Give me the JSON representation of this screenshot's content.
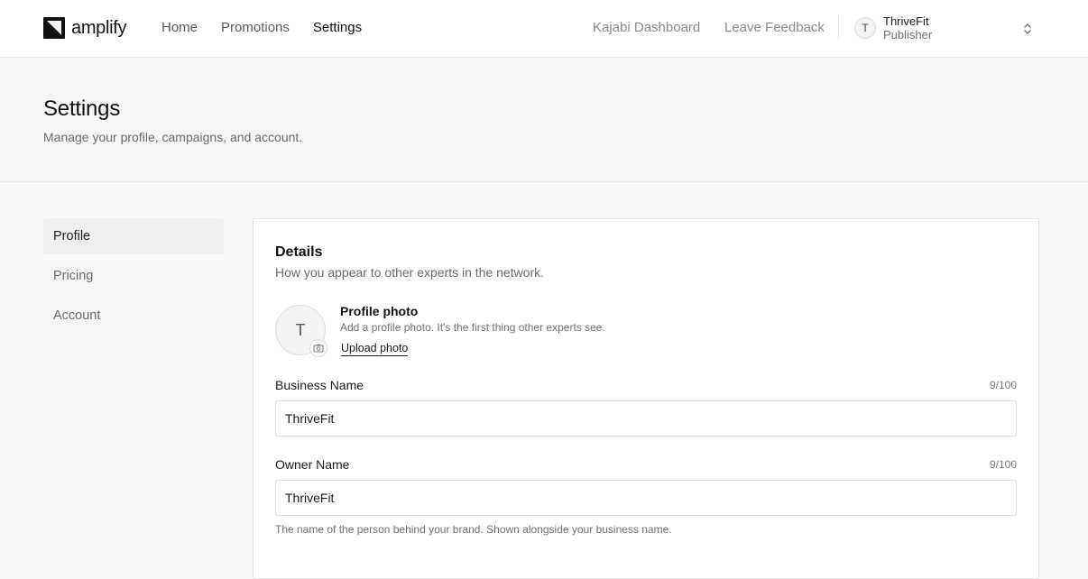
{
  "app": {
    "brand": "amplify",
    "nav": [
      {
        "label": "Home"
      },
      {
        "label": "Promotions"
      },
      {
        "label": "Settings"
      }
    ],
    "links": {
      "dashboard": "Kajabi Dashboard",
      "feedback": "Leave Feedback"
    },
    "user": {
      "initial": "T",
      "name": "ThriveFit",
      "role": "Publisher"
    }
  },
  "page": {
    "title": "Settings",
    "subtitle": "Manage your profile, campaigns, and account."
  },
  "sidebar": {
    "items": [
      {
        "label": "Profile",
        "active": true
      },
      {
        "label": "Pricing",
        "active": false
      },
      {
        "label": "Account",
        "active": false
      }
    ]
  },
  "details": {
    "title": "Details",
    "subtitle": "How you appear to other experts in the network.",
    "photo": {
      "initial": "T",
      "title": "Profile photo",
      "description": "Add a profile photo. It's the first thing other experts see.",
      "upload_label": "Upload photo"
    },
    "business_name": {
      "label": "Business Name",
      "count": "9/100",
      "value": "ThriveFit"
    },
    "owner_name": {
      "label": "Owner Name",
      "count": "9/100",
      "value": "ThriveFit",
      "help": "The name of the person behind your brand. Shown alongside your business name."
    }
  }
}
